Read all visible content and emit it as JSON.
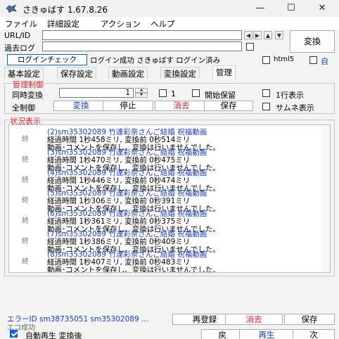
{
  "window": {
    "title": "さきゅばす 1.67.8.26",
    "minimize": "—",
    "maximize": "☐",
    "close": "✕"
  },
  "menu": [
    "ファイル",
    "詳細設定",
    "アクション",
    "ヘルプ"
  ],
  "url_label": "URL/ID",
  "past_log_label": "過去ログ",
  "convert_button": "変換",
  "login_check_button": "ログインチェック",
  "login_status": "ログイン成功 さきゅばす ログイン済み",
  "html5_label": "html5",
  "self_label": "自",
  "tabs": [
    "基本設定",
    "保存設定",
    "動画設定",
    "変換設定",
    "管理"
  ],
  "management": {
    "group_title": "管理制御",
    "simultaneous_label": "同時変換",
    "simultaneous_value": "1",
    "checkbox_one_label": "1",
    "start_hold_label": "開始保留",
    "one_line_label": "1行表示",
    "all_control_label": "全制御",
    "buttons": {
      "convert": "変換",
      "stop": "停止",
      "delete": "消去",
      "save": "保存"
    },
    "thumbnail_label": "サムネ表示"
  },
  "status_group_title": "状況表示",
  "log_entries": [
    {
      "status": "終",
      "title": "(2)sm35302089 竹達彩奈さんご結婚 祝福動画",
      "time": "経過時間 1秒458ミリ, 変換前 0秒514ミリ",
      "note": "動画･コメントを保存し、変換は行いませんでした。"
    },
    {
      "status": "終",
      "title": "(3)sm35302089 竹達彩奈さんご結婚 祝福動画",
      "time": "経過時間 1秒470ミリ, 変換前 0秒475ミリ",
      "note": "動画･コメントを保存し、変換は行いませんでした。"
    },
    {
      "status": "終",
      "title": "(4)sm35302089 竹達彩奈さんご結婚 祝福動画",
      "time": "経過時間 1秒446ミリ, 変換前 0秒474ミリ",
      "note": "動画･コメントを保存し、変換は行いませんでした。"
    },
    {
      "status": "終",
      "title": "(5)sm35302089 竹達彩奈さんご結婚 祝福動画",
      "time": "経過時間 1秒306ミリ, 変換前 0秒391ミリ",
      "note": "動画･コメントを保存し、変換は行いませんでした。"
    },
    {
      "status": "終",
      "title": "(6)sm35302089 竹達彩奈さんご結婚 祝福動画",
      "time": "経過時間 1秒361ミリ, 変換前 0秒375ミリ",
      "note": "動画･コメントを保存し、変換は行いませんでした。"
    },
    {
      "status": "終",
      "title": "(7)sm35302089 竹達彩奈さんご結婚 祝福動画",
      "time": "経過時間 1秒386ミリ, 変換前 0秒409ミリ",
      "note": "動画･コメントを保存し、変換は行いませんでした。"
    },
    {
      "status": "終",
      "title": "(8)sm35302089 竹達彩奈さんご結婚 祝福動画",
      "time": "経過時間 1秒407ミリ, 変換前 0秒483ミリ",
      "note": "動画･コメントを保存し、変換は行いませんでした。"
    }
  ],
  "bottom": {
    "error_id_text": "エラーID sm38735051 sm35302089 ...",
    "success_text": "エコ成功",
    "re_register_button": "再登録",
    "delete_button": "消去",
    "save_button": "保存",
    "auto_play_label": "自動再生 変換後",
    "back_button": "戻",
    "play_button": "再生",
    "next_button": "次"
  },
  "colors": {
    "accent_red": "#e0202a",
    "link_blue": "#1a3ccf",
    "check_blue": "#0a64d8"
  }
}
